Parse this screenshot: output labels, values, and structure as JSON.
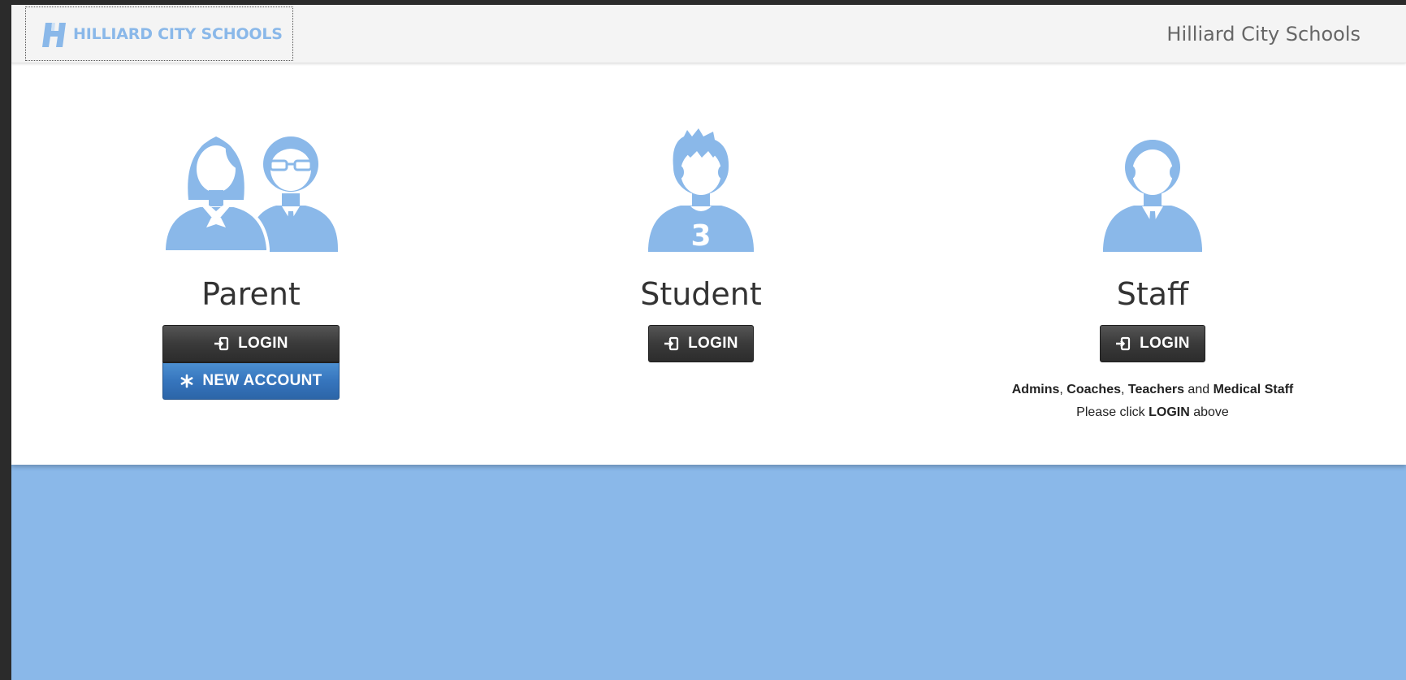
{
  "header": {
    "brand_text": "HILLIARD CITY SCHOOLS",
    "site_name": "Hilliard City Schools"
  },
  "colors": {
    "brand_blue": "#8ab8e9",
    "button_dark": "#3a3a3a",
    "button_blue": "#3675bd"
  },
  "roles": {
    "parent": {
      "title": "Parent",
      "login_label": "LOGIN",
      "new_account_label": "NEW ACCOUNT"
    },
    "student": {
      "title": "Student",
      "jersey_number": "3",
      "login_label": "LOGIN"
    },
    "staff": {
      "title": "Staff",
      "login_label": "LOGIN",
      "note": {
        "line1": {
          "r1": "Admins",
          "s1": ", ",
          "r2": "Coaches",
          "s2": ", ",
          "r3": "Teachers",
          "s3": " and ",
          "r4": "Medical Staff"
        },
        "line2": {
          "pre": "Please click ",
          "action": "LOGIN",
          "post": " above"
        }
      }
    }
  }
}
